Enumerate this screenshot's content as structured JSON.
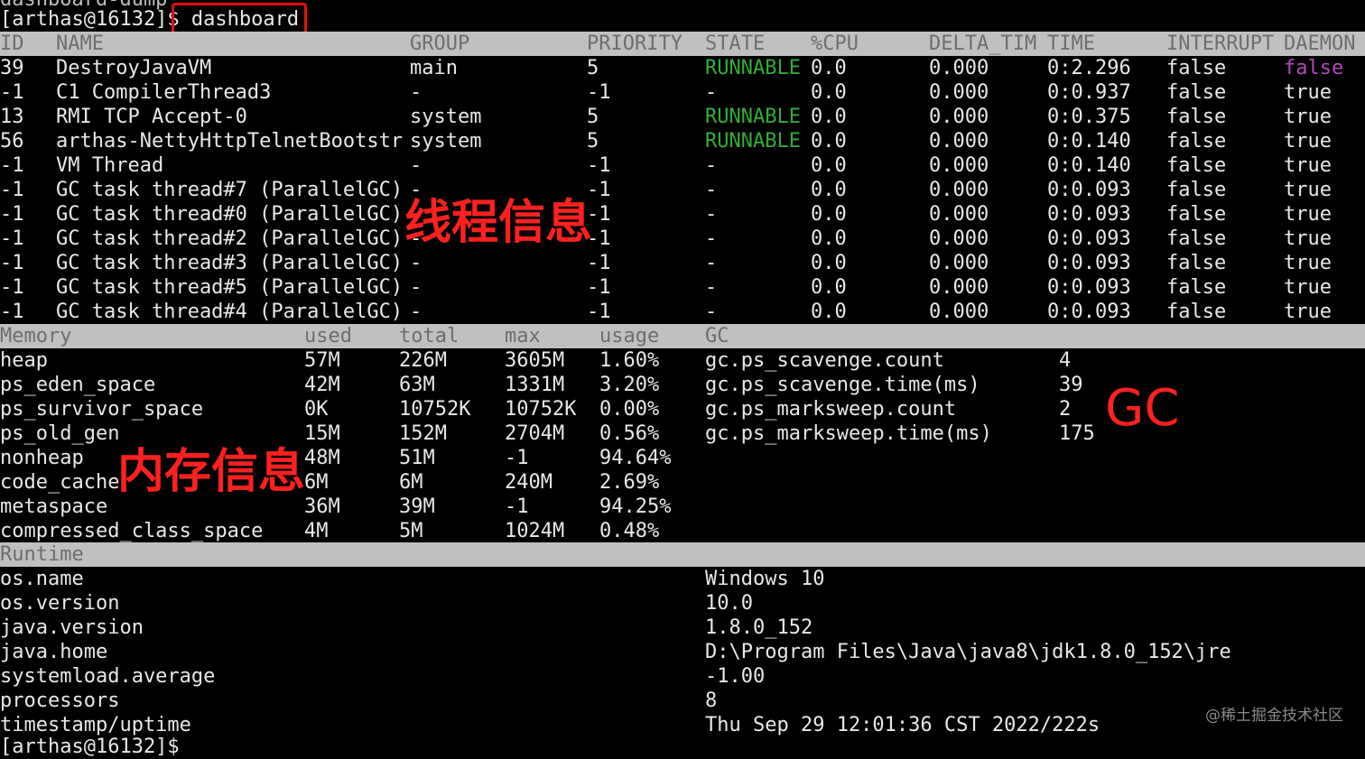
{
  "terminal": {
    "prev_line": "dashboard-dump",
    "prompt": "[arthas@16132]$ ",
    "command": "dashboard",
    "next_prompt": "[arthas@16132]$"
  },
  "threads": {
    "headers": [
      "ID",
      "NAME",
      "GROUP",
      "PRIORITY",
      "STATE",
      "%CPU",
      "DELTA_TIM",
      "TIME",
      "INTERRUPT",
      "DAEMON"
    ],
    "rows": [
      [
        "39",
        "DestroyJavaVM",
        "main",
        "5",
        "RUNNABLE",
        "0.0",
        "0.000",
        "0:2.296",
        "false",
        "false"
      ],
      [
        "-1",
        "C1 CompilerThread3",
        "-",
        "-1",
        "-",
        "0.0",
        "0.000",
        "0:0.937",
        "false",
        "true"
      ],
      [
        "13",
        "RMI TCP Accept-0",
        "system",
        "5",
        "RUNNABLE",
        "0.0",
        "0.000",
        "0:0.375",
        "false",
        "true"
      ],
      [
        "56",
        "arthas-NettyHttpTelnetBootstr",
        "system",
        "5",
        "RUNNABLE",
        "0.0",
        "0.000",
        "0:0.140",
        "false",
        "true"
      ],
      [
        "-1",
        "VM Thread",
        "-",
        "-1",
        "-",
        "0.0",
        "0.000",
        "0:0.140",
        "false",
        "true"
      ],
      [
        "-1",
        "GC task thread#7 (ParallelGC)",
        "-",
        "-1",
        "-",
        "0.0",
        "0.000",
        "0:0.093",
        "false",
        "true"
      ],
      [
        "-1",
        "GC task thread#0 (ParallelGC)",
        "-",
        "-1",
        "-",
        "0.0",
        "0.000",
        "0:0.093",
        "false",
        "true"
      ],
      [
        "-1",
        "GC task thread#2 (ParallelGC)",
        "-",
        "-1",
        "-",
        "0.0",
        "0.000",
        "0:0.093",
        "false",
        "true"
      ],
      [
        "-1",
        "GC task thread#3 (ParallelGC)",
        "-",
        "-1",
        "-",
        "0.0",
        "0.000",
        "0:0.093",
        "false",
        "true"
      ],
      [
        "-1",
        "GC task thread#5 (ParallelGC)",
        "-",
        "-1",
        "-",
        "0.0",
        "0.000",
        "0:0.093",
        "false",
        "true"
      ],
      [
        "-1",
        "GC task thread#4 (ParallelGC)",
        "-",
        "-1",
        "-",
        "0.0",
        "0.000",
        "0:0.093",
        "false",
        "true"
      ]
    ]
  },
  "memory": {
    "headers": [
      "Memory",
      "used",
      "total",
      "max",
      "usage",
      "GC"
    ],
    "rows": [
      [
        "heap",
        "57M",
        "226M",
        "3605M",
        "1.60%"
      ],
      [
        "ps_eden_space",
        "42M",
        "63M",
        "1331M",
        "3.20%"
      ],
      [
        "ps_survivor_space",
        "0K",
        "10752K",
        "10752K",
        "0.00%"
      ],
      [
        "ps_old_gen",
        "15M",
        "152M",
        "2704M",
        "0.56%"
      ],
      [
        "nonheap",
        "48M",
        "51M",
        "-1",
        "94.64%"
      ],
      [
        "code_cache",
        "6M",
        "6M",
        "240M",
        "2.69%"
      ],
      [
        "metaspace",
        "36M",
        "39M",
        "-1",
        "94.25%"
      ],
      [
        "compressed_class_space",
        "4M",
        "5M",
        "1024M",
        "0.48%"
      ]
    ]
  },
  "gc": {
    "rows": [
      [
        "gc.ps_scavenge.count",
        "4"
      ],
      [
        "gc.ps_scavenge.time(ms)",
        "39"
      ],
      [
        "gc.ps_marksweep.count",
        "2"
      ],
      [
        "gc.ps_marksweep.time(ms)",
        "175"
      ]
    ]
  },
  "runtime": {
    "header": "Runtime",
    "rows": [
      [
        "os.name",
        "Windows 10"
      ],
      [
        "os.version",
        "10.0"
      ],
      [
        "java.version",
        "1.8.0_152"
      ],
      [
        "java.home",
        "D:\\Program Files\\Java\\java8\\jdk1.8.0_152\\jre"
      ],
      [
        "systemload.average",
        "-1.00"
      ],
      [
        "processors",
        "8"
      ],
      [
        "timestamp/uptime",
        "Thu Sep 29 12:01:36 CST 2022/222s"
      ]
    ]
  },
  "annotations": {
    "threads_label": "线程信息",
    "memory_label": "内存信息",
    "gc_label": "GC"
  },
  "watermark": "@稀土掘金技术社区",
  "colors": {
    "header_bg": "#c0c0c0",
    "runnable": "#2fae3a",
    "annotation_red": "#ff2020",
    "daemon_false": "#b04ab8"
  }
}
